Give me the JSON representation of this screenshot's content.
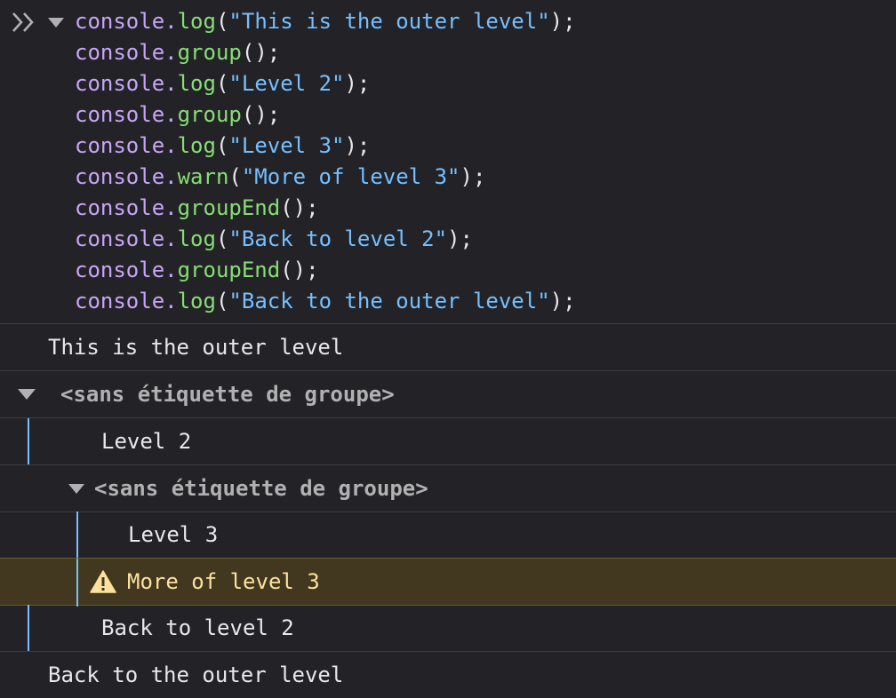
{
  "input": {
    "lines": [
      {
        "obj": "console",
        "dot": ".",
        "fn": "log",
        "open": "(",
        "str": "\"This is the outer level\"",
        "close": ");"
      },
      {
        "obj": "console",
        "dot": ".",
        "fn": "group",
        "open": "(",
        "str": "",
        "close": ");"
      },
      {
        "obj": "console",
        "dot": ".",
        "fn": "log",
        "open": "(",
        "str": "\"Level 2\"",
        "close": ");"
      },
      {
        "obj": "console",
        "dot": ".",
        "fn": "group",
        "open": "(",
        "str": "",
        "close": ");"
      },
      {
        "obj": "console",
        "dot": ".",
        "fn": "log",
        "open": "(",
        "str": "\"Level 3\"",
        "close": ");"
      },
      {
        "obj": "console",
        "dot": ".",
        "fn": "warn",
        "open": "(",
        "str": "\"More of level 3\"",
        "close": ");"
      },
      {
        "obj": "console",
        "dot": ".",
        "fn": "groupEnd",
        "open": "(",
        "str": "",
        "close": ");"
      },
      {
        "obj": "console",
        "dot": ".",
        "fn": "log",
        "open": "(",
        "str": "\"Back to level 2\"",
        "close": ");"
      },
      {
        "obj": "console",
        "dot": ".",
        "fn": "groupEnd",
        "open": "(",
        "str": "",
        "close": ");"
      },
      {
        "obj": "console",
        "dot": ".",
        "fn": "log",
        "open": "(",
        "str": "\"Back to the outer level\"",
        "close": ");"
      }
    ]
  },
  "output": {
    "msg_outer": "This is the outer level",
    "group1_label": "<sans étiquette de groupe>",
    "msg_level2": "Level 2",
    "group2_label": "<sans étiquette de groupe>",
    "msg_level3": "Level 3",
    "warn_level3": "More of level 3",
    "msg_back_level2": "Back to level 2",
    "msg_back_outer": "Back to the outer level"
  },
  "colors": {
    "background": "#232327",
    "console_obj": "#c7a5f7",
    "function": "#86de74",
    "string": "#75bfff",
    "warning_bg": "#42381f",
    "warning_text": "#fce19f",
    "group_bar": "#75bfff"
  },
  "icons": [
    "prompt-chevrons-icon",
    "expand-triangle-icon",
    "warning-icon"
  ]
}
